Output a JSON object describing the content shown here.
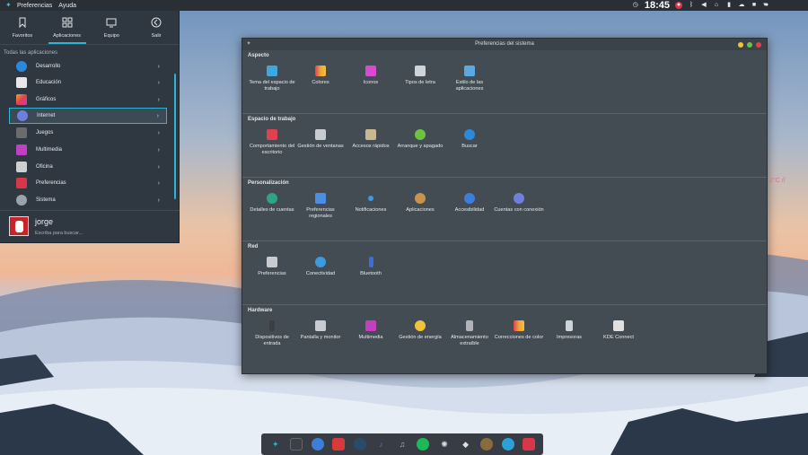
{
  "top_panel": {
    "menus": [
      "Preferencias",
      "Ayuda"
    ],
    "clock": "18:45",
    "tray_icons": [
      "clock-icon",
      "notification-badge-icon",
      "bluetooth-icon",
      "volume-icon",
      "network-icon",
      "battery-icon",
      "cloud-icon",
      "lock-icon",
      "user-icon"
    ]
  },
  "launcher": {
    "tabs": [
      {
        "label": "Favoritos",
        "icon": "bookmark-icon"
      },
      {
        "label": "Aplicaciones",
        "icon": "grid-icon",
        "active": true
      },
      {
        "label": "Equipo",
        "icon": "monitor-icon"
      },
      {
        "label": "Salir",
        "icon": "back-icon"
      }
    ],
    "heading": "Todas las aplicaciones",
    "categories": [
      {
        "label": "Desarrollo",
        "color": "#2a8ad8"
      },
      {
        "label": "Educación",
        "color": "#e8e8e8"
      },
      {
        "label": "Gráficos",
        "color": "#f2a33a"
      },
      {
        "label": "Internet",
        "color": "#6f7fdc",
        "selected": true
      },
      {
        "label": "Juegos",
        "color": "#6b6b6b"
      },
      {
        "label": "Multimedia",
        "color": "#c040c0"
      },
      {
        "label": "Oficina",
        "color": "#d0d0d0"
      },
      {
        "label": "Preferencias",
        "color": "#d8364a"
      },
      {
        "label": "Sistema",
        "color": "#9aa3ab"
      }
    ],
    "user": {
      "name": "jorge",
      "search_placeholder": "Escriba para buscar..."
    }
  },
  "window": {
    "title": "Preferencias del sistema",
    "sections": [
      {
        "title": "Aspecto",
        "items": [
          {
            "label": "Tema del espacio de trabajo",
            "color": "#3fa7df"
          },
          {
            "label": "Colores",
            "color": "#f2a33a"
          },
          {
            "label": "Iconos",
            "color": "#d84bd0"
          },
          {
            "label": "Tipos de letra",
            "color": "#d0d4d8"
          },
          {
            "label": "Estilo de las aplicaciones",
            "color": "#5aa9e0"
          }
        ]
      },
      {
        "title": "Espacio de trabajo",
        "items": [
          {
            "label": "Comportamiento del escritorio",
            "color": "#e0404f"
          },
          {
            "label": "Gestión de ventanas",
            "color": "#c8ccd0"
          },
          {
            "label": "Accesos rápidos",
            "color": "#c8b890"
          },
          {
            "label": "Arranque y apagado",
            "color": "#6dc243"
          },
          {
            "label": "Buscar",
            "color": "#2a8ad8"
          }
        ]
      },
      {
        "title": "Personalización",
        "items": [
          {
            "label": "Detalles de cuentas",
            "color": "#2fa38a"
          },
          {
            "label": "Preferencias regionales",
            "color": "#4c8ee0"
          },
          {
            "label": "Notificaciones",
            "color": "#3b9be0"
          },
          {
            "label": "Aplicaciones",
            "color": "#c8934b"
          },
          {
            "label": "Accesibilidad",
            "color": "#3b7fd8"
          },
          {
            "label": "Cuentas con conexión",
            "color": "#6f7fdc"
          }
        ]
      },
      {
        "title": "Red",
        "items": [
          {
            "label": "Preferencias",
            "color": "#c8ccd0"
          },
          {
            "label": "Conectividad",
            "color": "#3b9be0"
          },
          {
            "label": "Bluetooth",
            "color": "#3b6fd8"
          }
        ]
      },
      {
        "title": "Hardware",
        "items": [
          {
            "label": "Dispositivos de entrada",
            "color": "#3b3f44"
          },
          {
            "label": "Pantalla y monitor",
            "color": "#c8ccd0"
          },
          {
            "label": "Multimedia",
            "color": "#c040c0"
          },
          {
            "label": "Gestión de energía",
            "color": "#f2c23a"
          },
          {
            "label": "Almacenamiento extraíble",
            "color": "#b0b4b8"
          },
          {
            "label": "Correcciones de color",
            "color": "#f2a33a"
          },
          {
            "label": "Impresoras",
            "color": "#d0d4d8"
          },
          {
            "label": "KDE Connect",
            "color": "#e0e0e0"
          }
        ]
      }
    ]
  },
  "dock": {
    "icons": [
      {
        "name": "launcher-icon",
        "color": "#2bb6d4"
      },
      {
        "name": "terminal-icon",
        "color": "#3b4048"
      },
      {
        "name": "qbittorrent-icon",
        "color": "#3b7fd8"
      },
      {
        "name": "vivaldi-icon",
        "color": "#d83a3a"
      },
      {
        "name": "steam-icon",
        "color": "#2a4a6a"
      },
      {
        "name": "music-player-icon",
        "color": "#3b7fd8"
      },
      {
        "name": "music-note-icon",
        "color": "#7a7f88"
      },
      {
        "name": "spotify-icon",
        "color": "#1db954"
      },
      {
        "name": "syncthing-icon",
        "color": "#e0e0e0"
      },
      {
        "name": "inkscape-icon",
        "color": "#e0e0e0"
      },
      {
        "name": "gimp-icon",
        "color": "#8a6b3a"
      },
      {
        "name": "telegram-icon",
        "color": "#2aa1d8"
      },
      {
        "name": "preferences-icon",
        "color": "#d8364a"
      }
    ]
  },
  "desktop": {
    "weather_text": "2°C //"
  }
}
